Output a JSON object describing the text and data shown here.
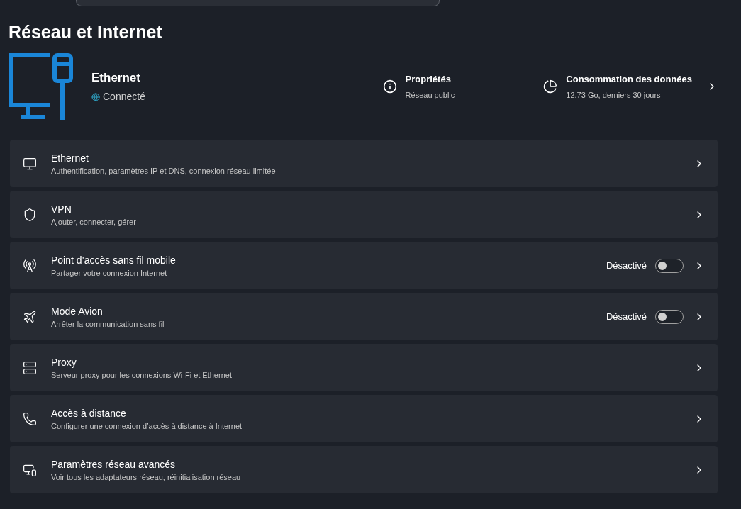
{
  "page": {
    "title": "Réseau et Internet"
  },
  "connection": {
    "name": "Ethernet",
    "status": "Connecté"
  },
  "properties": {
    "title": "Propriétés",
    "subtitle": "Réseau public"
  },
  "data_usage": {
    "title": "Consommation des données",
    "subtitle": "12.73 Go, derniers 30 jours"
  },
  "settings": [
    {
      "kind": "link",
      "title": "Ethernet",
      "subtitle": "Authentification, paramètres IP et DNS, connexion réseau limitée"
    },
    {
      "kind": "link",
      "title": "VPN",
      "subtitle": "Ajouter, connecter, gérer"
    },
    {
      "kind": "toggle",
      "title": "Point d’accès sans fil mobile",
      "subtitle": "Partager votre connexion Internet",
      "state_label": "Désactivé",
      "on": false
    },
    {
      "kind": "toggle",
      "title": "Mode Avion",
      "subtitle": "Arrêter la communication sans fil",
      "state_label": "Désactivé",
      "on": false
    },
    {
      "kind": "link",
      "title": "Proxy",
      "subtitle": "Serveur proxy pour les connexions Wi-Fi et Ethernet"
    },
    {
      "kind": "link",
      "title": "Accès à distance",
      "subtitle": "Configurer une connexion d’accès à distance à Internet"
    },
    {
      "kind": "link",
      "title": "Paramètres réseau avancés",
      "subtitle": "Voir tous les adaptateurs réseau, réinitialisation réseau"
    }
  ]
}
